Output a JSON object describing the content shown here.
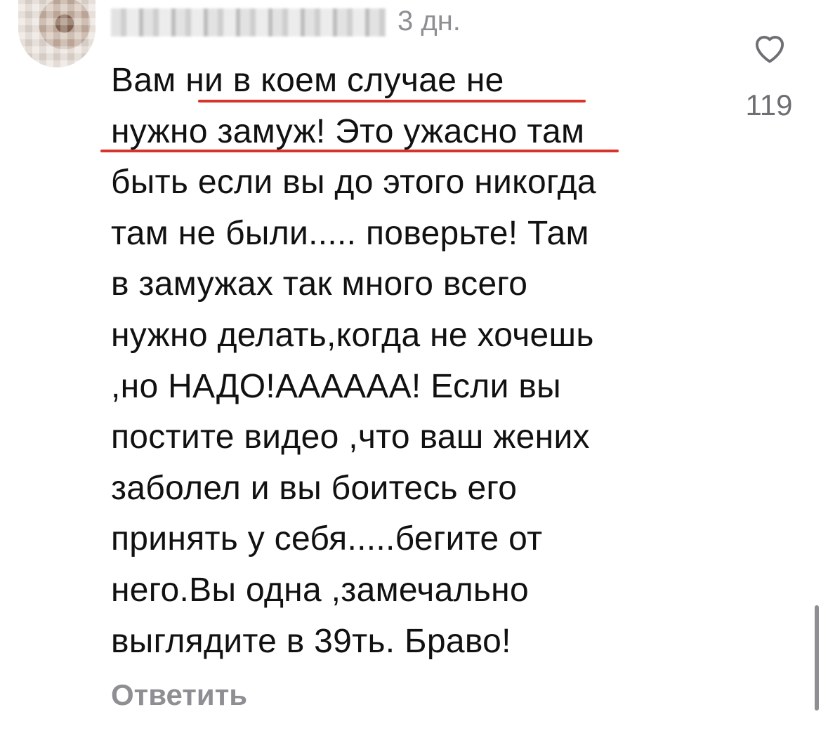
{
  "comment": {
    "time_text": "3 дн.",
    "lines": [
      "Вам ни в коем случае не",
      "нужно замуж! Это ужасно там",
      "быть если вы до этого никогда",
      "там не были..... поверьте! Там",
      "в замужах так много всего",
      "нужно делать,когда не хочешь",
      ",но НАДО!АААААА! Если вы",
      "постите видео ,что ваш жених",
      "заболел и вы боитесь его",
      "принять у себя.....бегите от",
      "него.Вы одна ,замечально",
      "выглядите в 39ть. Браво!"
    ],
    "reply_label": "Ответить",
    "like_count": "119",
    "underline_color": "#d9342b"
  },
  "icons": {
    "like": "heart-outline-icon"
  }
}
